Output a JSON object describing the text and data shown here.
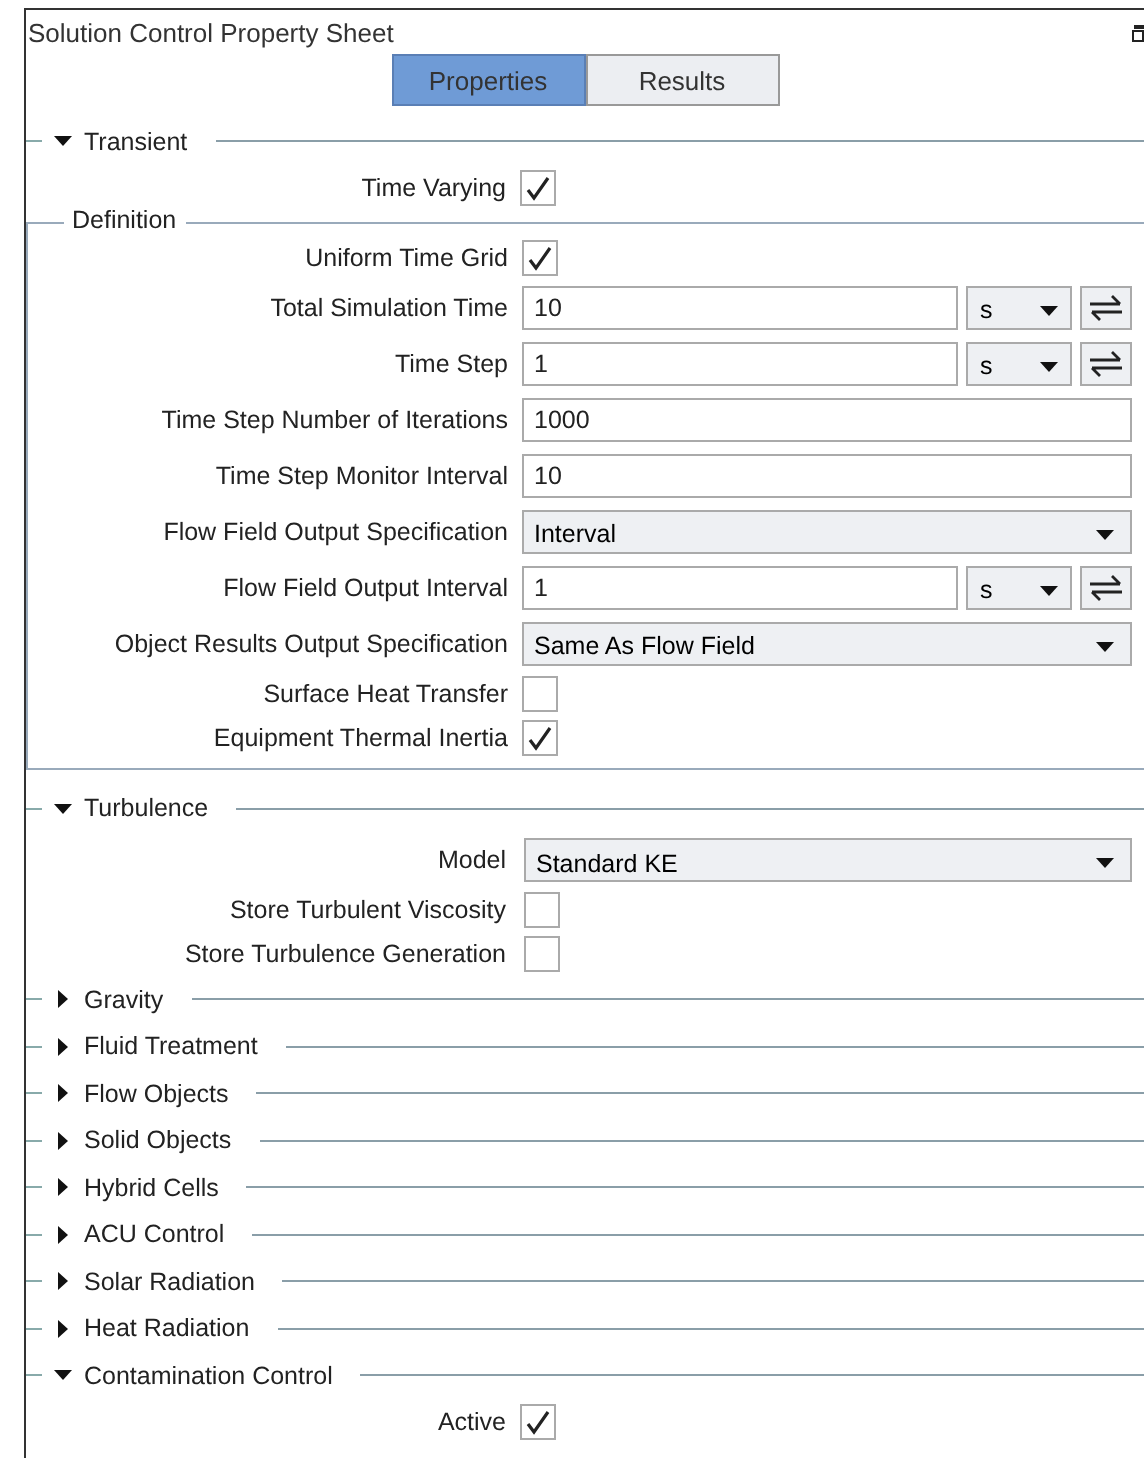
{
  "window": {
    "title": "Solution Control Property Sheet"
  },
  "tabs": [
    {
      "label": "Properties",
      "selected": true
    },
    {
      "label": "Results",
      "selected": false
    }
  ],
  "sections": [
    {
      "title": "Transient",
      "expanded": true,
      "items": [
        {
          "kind": "checkbox",
          "label": "Time Varying",
          "checked": true
        },
        {
          "kind": "group",
          "title": "Definition",
          "items": [
            {
              "kind": "checkbox",
              "label": "Uniform Time Grid",
              "checked": true
            },
            {
              "kind": "unit",
              "label": "Total Simulation Time",
              "value": "10",
              "unit": "s"
            },
            {
              "kind": "unit",
              "label": "Time Step",
              "value": "1",
              "unit": "s"
            },
            {
              "kind": "text",
              "label": "Time Step Number of Iterations",
              "value": "1000"
            },
            {
              "kind": "text",
              "label": "Time Step Monitor Interval",
              "value": "10"
            },
            {
              "kind": "select",
              "label": "Flow Field Output Specification",
              "value": "Interval"
            },
            {
              "kind": "unit",
              "label": "Flow Field Output Interval",
              "value": "1",
              "unit": "s"
            },
            {
              "kind": "select",
              "label": "Object Results Output Specification",
              "value": "Same As Flow Field"
            },
            {
              "kind": "checkbox",
              "label": "Surface Heat Transfer",
              "checked": false
            },
            {
              "kind": "checkbox",
              "label": "Equipment Thermal Inertia",
              "checked": true
            }
          ]
        }
      ]
    },
    {
      "title": "Turbulence",
      "expanded": true,
      "items": [
        {
          "kind": "select",
          "label": "Model",
          "value": "Standard KE"
        },
        {
          "kind": "checkbox",
          "label": "Store Turbulent Viscosity",
          "checked": false
        },
        {
          "kind": "checkbox",
          "label": "Store Turbulence Generation",
          "checked": false
        }
      ]
    },
    {
      "title": "Gravity",
      "expanded": false
    },
    {
      "title": "Fluid Treatment",
      "expanded": false
    },
    {
      "title": "Flow Objects",
      "expanded": false
    },
    {
      "title": "Solid Objects",
      "expanded": false
    },
    {
      "title": "Hybrid Cells",
      "expanded": false
    },
    {
      "title": "ACU Control",
      "expanded": false
    },
    {
      "title": "Solar Radiation",
      "expanded": false
    },
    {
      "title": "Heat Radiation",
      "expanded": false
    },
    {
      "title": "Contamination Control",
      "expanded": true,
      "items": [
        {
          "kind": "checkbox",
          "label": "Active",
          "checked": true
        }
      ]
    }
  ]
}
